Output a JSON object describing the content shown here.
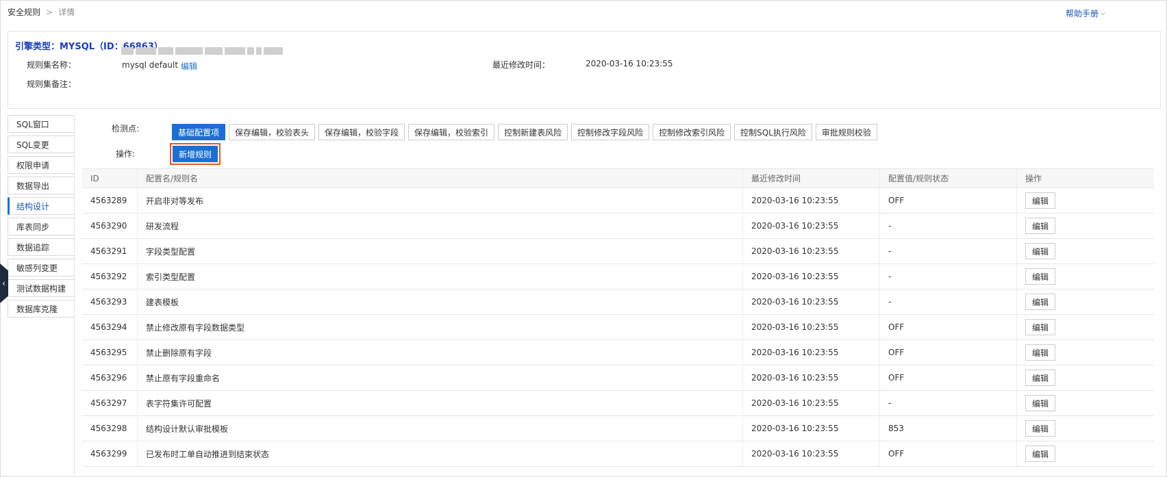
{
  "breadcrumb": {
    "root": "安全规则",
    "separator": ">",
    "current": "详情"
  },
  "help": {
    "label": "帮助手册",
    "chevron": "⌵"
  },
  "header": {
    "engine_title": "引擎类型：MYSQL（ID：66863）",
    "ruleset_name_label": "规则集名称：",
    "ruleset_name_value": "mysql default",
    "edit_link": "编辑",
    "last_modified_label": "最近修改时间：",
    "last_modified_value": "2020-03-16 10:23:55",
    "remark_label": "规则集备注："
  },
  "sidebar": {
    "items": [
      {
        "label": "SQL窗口",
        "active": false
      },
      {
        "label": "SQL变更",
        "active": false
      },
      {
        "label": "权限申请",
        "active": false
      },
      {
        "label": "数据导出",
        "active": false
      },
      {
        "label": "结构设计",
        "active": true
      },
      {
        "label": "库表同步",
        "active": false
      },
      {
        "label": "数据追踪",
        "active": false
      },
      {
        "label": "敏感列变更",
        "active": false
      },
      {
        "label": "测试数据构建",
        "active": false
      },
      {
        "label": "数据库克隆",
        "active": false
      }
    ],
    "collapse_icon": "‹"
  },
  "detection": {
    "label": "检测点:",
    "chips": [
      {
        "label": "基础配置项",
        "active": true
      },
      {
        "label": "保存编辑，校验表头",
        "active": false
      },
      {
        "label": "保存编辑，校验字段",
        "active": false
      },
      {
        "label": "保存编辑，校验索引",
        "active": false
      },
      {
        "label": "控制新建表风险",
        "active": false
      },
      {
        "label": "控制修改字段风险",
        "active": false
      },
      {
        "label": "控制修改索引风险",
        "active": false
      },
      {
        "label": "控制SQL执行风险",
        "active": false
      },
      {
        "label": "审批规则校验",
        "active": false
      }
    ]
  },
  "operation": {
    "label": "操作:",
    "add_rule": "新增规则"
  },
  "table": {
    "headers": [
      "ID",
      "配置名/规则名",
      "最近修改时间",
      "配置值/规则状态",
      "操作"
    ],
    "edit_label": "编辑",
    "rows": [
      {
        "id": "4563289",
        "name": "开启非对等发布",
        "time": "2020-03-16 10:23:55",
        "status": "OFF"
      },
      {
        "id": "4563290",
        "name": "研发流程",
        "time": "2020-03-16 10:23:55",
        "status": "-"
      },
      {
        "id": "4563291",
        "name": "字段类型配置",
        "time": "2020-03-16 10:23:55",
        "status": "-"
      },
      {
        "id": "4563292",
        "name": "索引类型配置",
        "time": "2020-03-16 10:23:55",
        "status": "-"
      },
      {
        "id": "4563293",
        "name": "建表模板",
        "time": "2020-03-16 10:23:55",
        "status": "-"
      },
      {
        "id": "4563294",
        "name": "禁止修改原有字段数据类型",
        "time": "2020-03-16 10:23:55",
        "status": "OFF"
      },
      {
        "id": "4563295",
        "name": "禁止删除原有字段",
        "time": "2020-03-16 10:23:55",
        "status": "OFF"
      },
      {
        "id": "4563296",
        "name": "禁止原有字段重命名",
        "time": "2020-03-16 10:23:55",
        "status": "OFF"
      },
      {
        "id": "4563297",
        "name": "表字符集许可配置",
        "time": "2020-03-16 10:23:55",
        "status": "-"
      },
      {
        "id": "4563298",
        "name": "结构设计默认审批模板",
        "time": "2020-03-16 10:23:55",
        "status": "853"
      },
      {
        "id": "4563299",
        "name": "已发布时工单自动推进到结束状态",
        "time": "2020-03-16 10:23:55",
        "status": "OFF"
      }
    ]
  },
  "colors": {
    "accent": "#1a6fd4",
    "title": "#1a3dbf",
    "highlight": "#e8572a"
  }
}
